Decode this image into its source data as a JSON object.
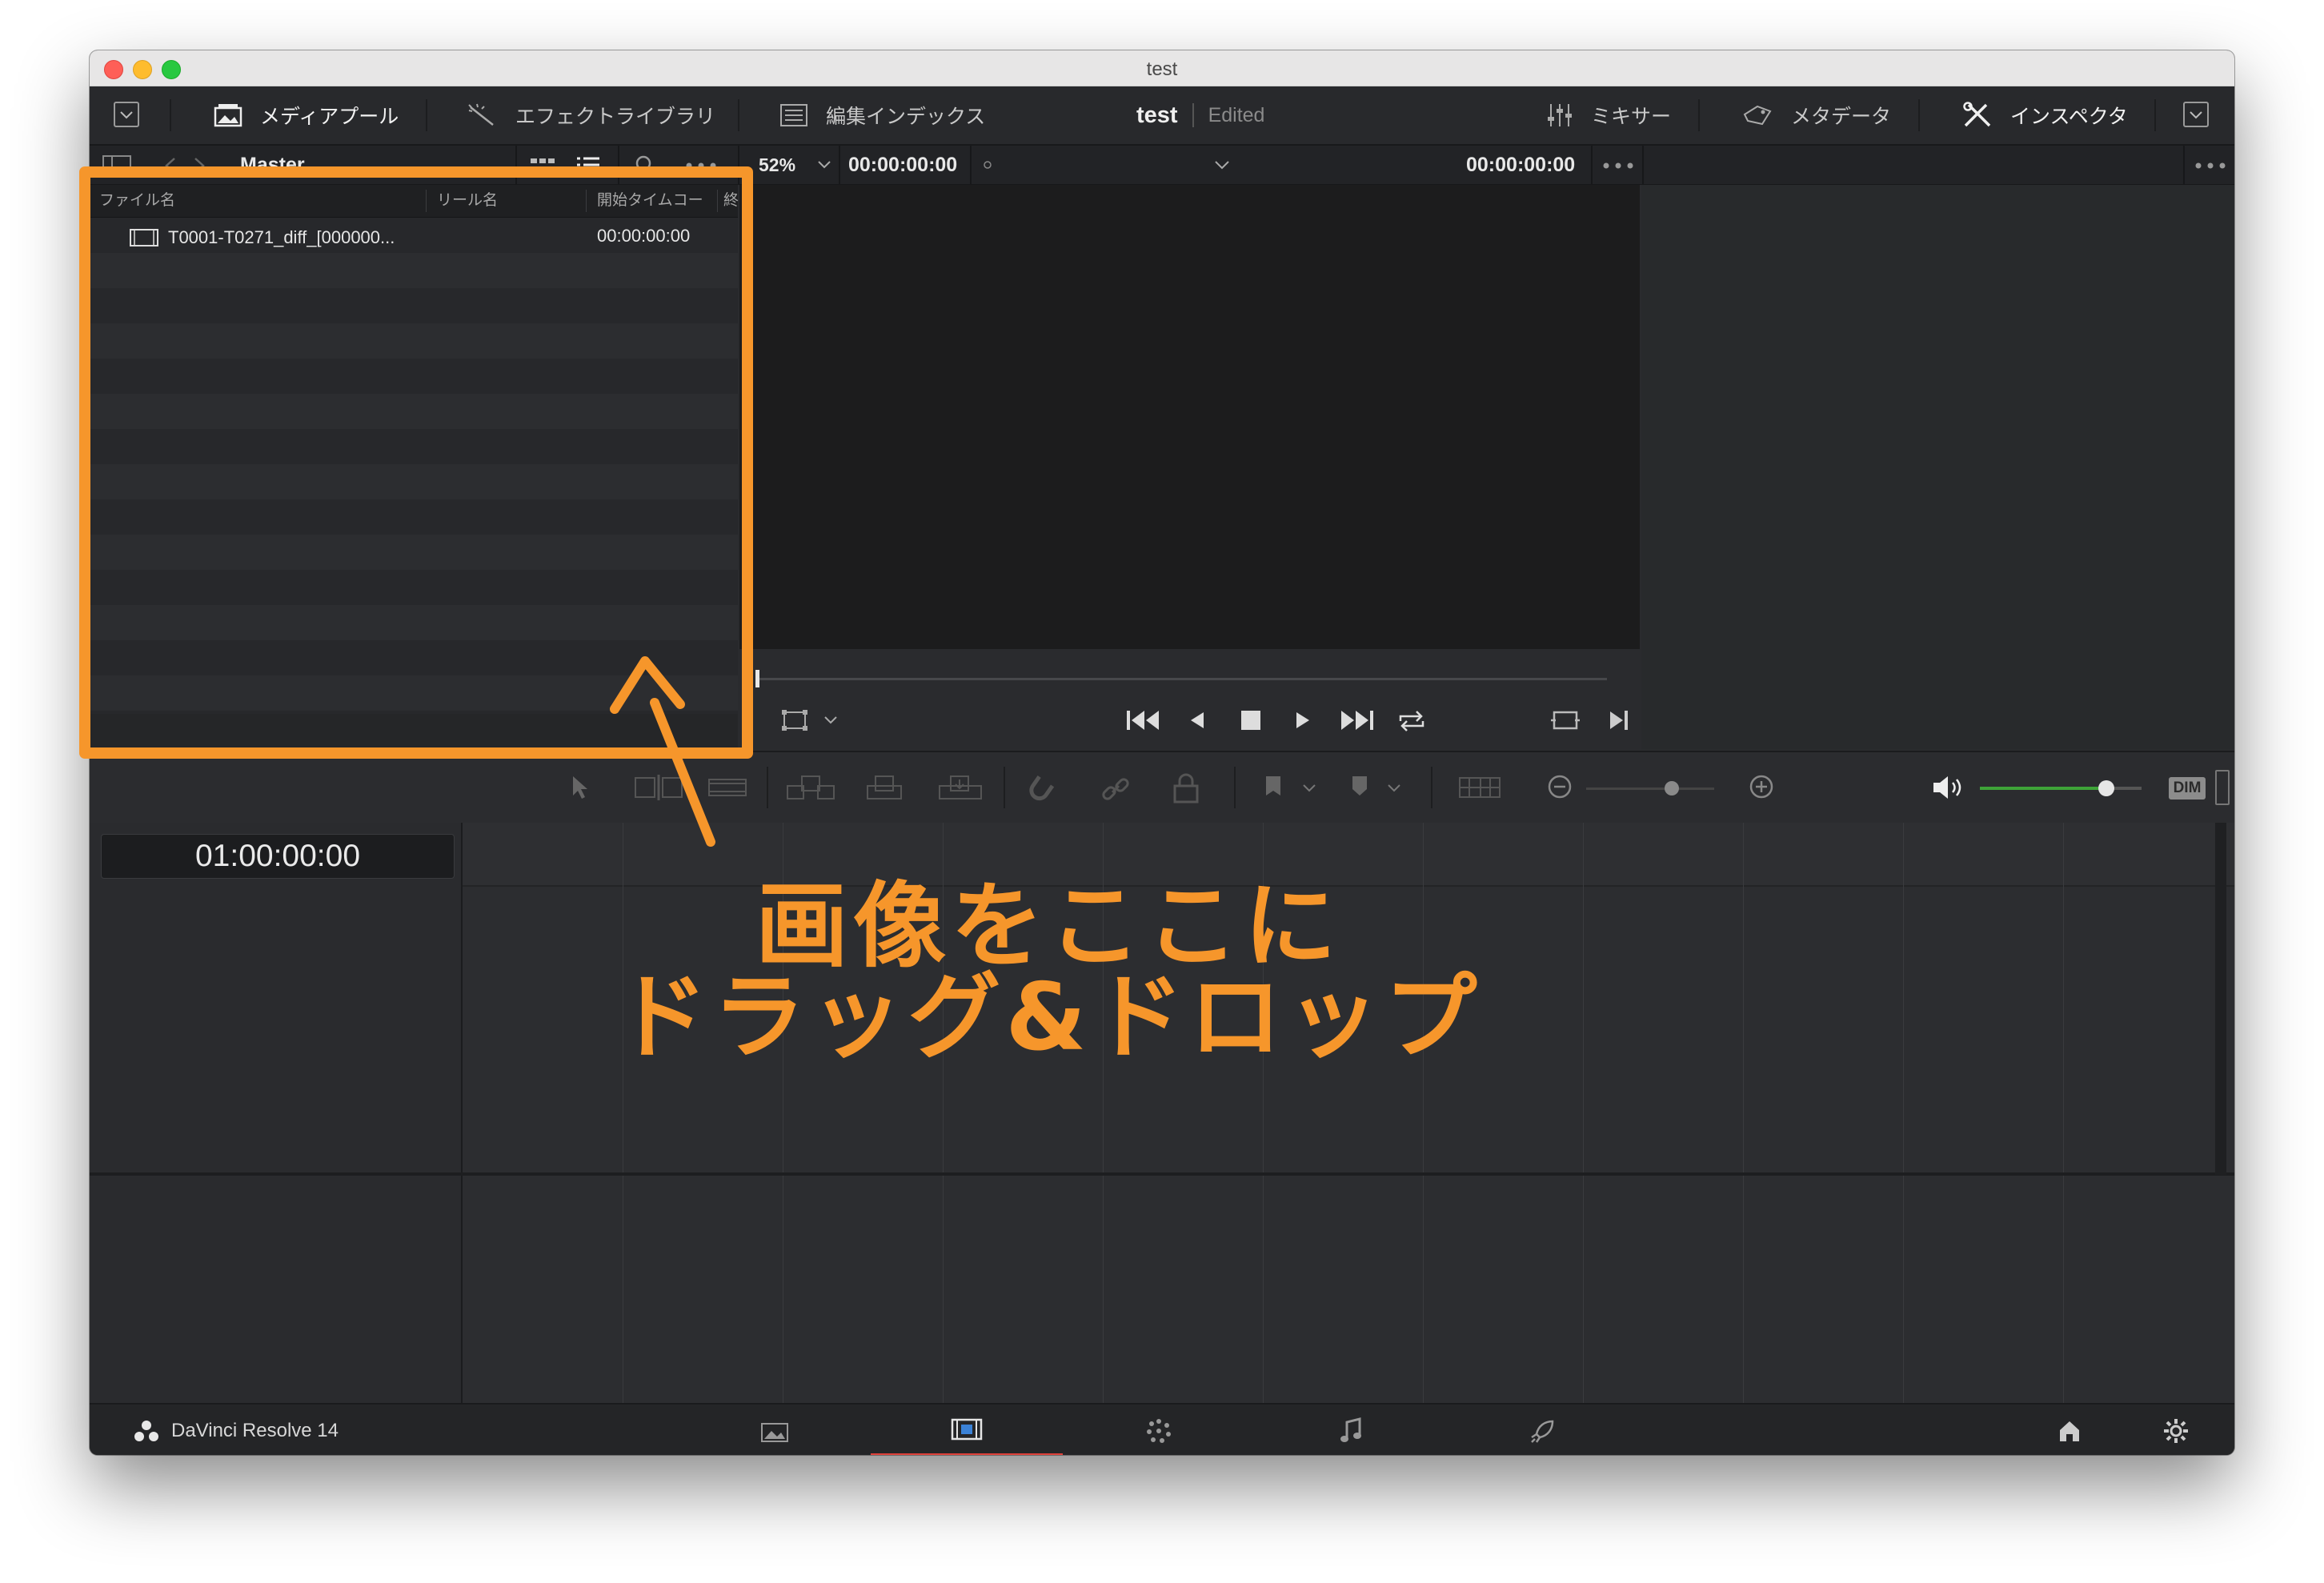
{
  "window": {
    "title": "test"
  },
  "toolbar": {
    "media_pool": "メディアプール",
    "effects_library": "エフェクトライブラリ",
    "edit_index": "編集インデックス",
    "project_name": "test",
    "project_status": "Edited",
    "mixer": "ミキサー",
    "metadata": "メタデータ",
    "inspector": "インスペクタ"
  },
  "pool": {
    "bin": "Master",
    "columns": [
      "ファイル名",
      "リール名",
      "開始タイムコー",
      "終"
    ],
    "clips": [
      {
        "name": "T0001-T0271_diff_[000000...",
        "start": "00:00:00:00"
      }
    ]
  },
  "viewer": {
    "zoom": "52%",
    "source_timecode": "00:00:00:00",
    "current_timecode": "00:00:00:00"
  },
  "audio": {
    "dim_label": "DIM"
  },
  "timeline": {
    "timecode": "01:00:00:00"
  },
  "app": {
    "name": "DaVinci Resolve 14"
  },
  "annotation": {
    "line1": "画像をここに",
    "line2": "ドラッグ&ドロップ"
  },
  "colors": {
    "accent": "#f6962b",
    "active_page": "#e0423b",
    "volume": "#3ea338"
  }
}
